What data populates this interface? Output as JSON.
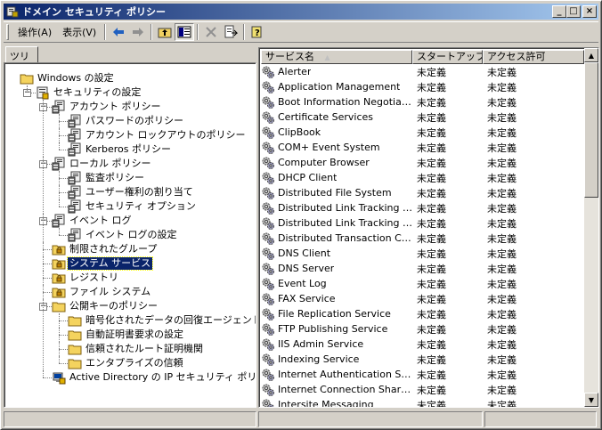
{
  "window": {
    "title": "ドメイン セキュリティ ポリシー",
    "min": "_",
    "max": "□",
    "close": "×"
  },
  "toolbar": {
    "action_menu": "操作(A)",
    "view_menu": "表示(V)"
  },
  "tree_tab": "ツリー",
  "tree": [
    {
      "label": "Windows の設定",
      "icon": "folder-icon",
      "level": 0,
      "toggle": "",
      "line": true
    },
    {
      "label": "セキュリティの設定",
      "icon": "security-settings-icon",
      "level": 1,
      "toggle": "−"
    },
    {
      "label": "アカウント ポリシー",
      "icon": "policy-icon",
      "level": 2,
      "toggle": "−"
    },
    {
      "label": "パスワードのポリシー",
      "icon": "policy-icon",
      "level": 3,
      "toggle": ""
    },
    {
      "label": "アカウント ロックアウトのポリシー",
      "icon": "policy-icon",
      "level": 3,
      "toggle": ""
    },
    {
      "label": "Kerberos ポリシー",
      "icon": "policy-icon",
      "level": 3,
      "toggle": ""
    },
    {
      "label": "ローカル ポリシー",
      "icon": "policy-icon",
      "level": 2,
      "toggle": "−"
    },
    {
      "label": "監査ポリシー",
      "icon": "policy-icon",
      "level": 3,
      "toggle": ""
    },
    {
      "label": "ユーザー権利の割り当て",
      "icon": "policy-icon",
      "level": 3,
      "toggle": ""
    },
    {
      "label": "セキュリティ オプション",
      "icon": "policy-icon",
      "level": 3,
      "toggle": ""
    },
    {
      "label": "イベント ログ",
      "icon": "policy-icon",
      "level": 2,
      "toggle": "−"
    },
    {
      "label": "イベント ログの設定",
      "icon": "policy-icon",
      "level": 3,
      "toggle": ""
    },
    {
      "label": "制限されたグループ",
      "icon": "lock-folder-icon",
      "level": 2,
      "toggle": ""
    },
    {
      "label": "システム サービス",
      "icon": "lock-folder-icon",
      "level": 2,
      "toggle": "",
      "selected": true
    },
    {
      "label": "レジストリ",
      "icon": "lock-folder-icon",
      "level": 2,
      "toggle": ""
    },
    {
      "label": "ファイル システム",
      "icon": "lock-folder-icon",
      "level": 2,
      "toggle": ""
    },
    {
      "label": "公開キーのポリシー",
      "icon": "folder-icon",
      "level": 2,
      "toggle": "−"
    },
    {
      "label": "暗号化されたデータの回復エージェント",
      "icon": "folder-icon",
      "level": 3,
      "toggle": ""
    },
    {
      "label": "自動証明書要求の設定",
      "icon": "folder-icon",
      "level": 3,
      "toggle": ""
    },
    {
      "label": "信頼されたルート証明機関",
      "icon": "folder-icon",
      "level": 3,
      "toggle": ""
    },
    {
      "label": "エンタプライズの信頼",
      "icon": "folder-icon",
      "level": 3,
      "toggle": ""
    },
    {
      "label": "Active Directory の IP セキュリティ ポリシー",
      "icon": "ip-security-icon",
      "level": 2,
      "toggle": ""
    }
  ],
  "list": {
    "columns": [
      "サービス名",
      "スタートアップ",
      "アクセス許可"
    ],
    "sort_indicator": "▲",
    "rows": [
      [
        "Alerter",
        "未定義",
        "未定義"
      ],
      [
        "Application Management",
        "未定義",
        "未定義"
      ],
      [
        "Boot Information Negotiatio...",
        "未定義",
        "未定義"
      ],
      [
        "Certificate Services",
        "未定義",
        "未定義"
      ],
      [
        "ClipBook",
        "未定義",
        "未定義"
      ],
      [
        "COM+ Event System",
        "未定義",
        "未定義"
      ],
      [
        "Computer Browser",
        "未定義",
        "未定義"
      ],
      [
        "DHCP Client",
        "未定義",
        "未定義"
      ],
      [
        "Distributed File System",
        "未定義",
        "未定義"
      ],
      [
        "Distributed Link Tracking C...",
        "未定義",
        "未定義"
      ],
      [
        "Distributed Link Tracking S...",
        "未定義",
        "未定義"
      ],
      [
        "Distributed Transaction Co...",
        "未定義",
        "未定義"
      ],
      [
        "DNS Client",
        "未定義",
        "未定義"
      ],
      [
        "DNS Server",
        "未定義",
        "未定義"
      ],
      [
        "Event Log",
        "未定義",
        "未定義"
      ],
      [
        "FAX Service",
        "未定義",
        "未定義"
      ],
      [
        "File Replication Service",
        "未定義",
        "未定義"
      ],
      [
        "FTP Publishing Service",
        "未定義",
        "未定義"
      ],
      [
        "IIS Admin Service",
        "未定義",
        "未定義"
      ],
      [
        "Indexing Service",
        "未定義",
        "未定義"
      ],
      [
        "Internet Authentication Ser...",
        "未定義",
        "未定義"
      ],
      [
        "Internet Connection Sharing",
        "未定義",
        "未定義"
      ],
      [
        "Intersite Messaging",
        "未定義",
        "未定義"
      ]
    ]
  },
  "colors": {
    "title_start": "#0a246a",
    "title_end": "#a6caf0",
    "selection": "#0a246a",
    "face": "#d4d0c8"
  }
}
